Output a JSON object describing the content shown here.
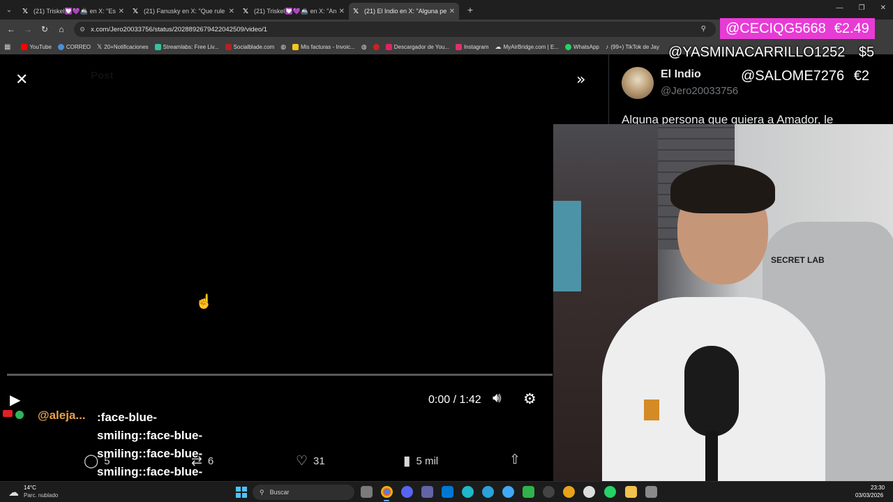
{
  "browser": {
    "tabs": [
      {
        "title": "(21) Triskel💟💜🚢 en X: \"Es o",
        "active": false
      },
      {
        "title": "(21) Fanusky en X: \"Que rule es",
        "active": false
      },
      {
        "title": "(21) Triskel💟💜🚢 en X: \"Ant",
        "active": false
      },
      {
        "title": "(21) El Indio en X: \"Alguna pers",
        "active": true
      }
    ],
    "url": "x.com/Jero20033756/status/2028892679422042509/video/1",
    "bookmarks": [
      {
        "label": "YouTube",
        "color": "#ff0000"
      },
      {
        "label": "CORREO",
        "color": "#4a90d9"
      },
      {
        "label": "20+Notificaciones",
        "color": "#ffffff"
      },
      {
        "label": "Streamlabs: Free Liv...",
        "color": "#31c3a2"
      },
      {
        "label": "Socialblade.com",
        "color": "#b22222"
      },
      {
        "label": "",
        "color": "#888888"
      },
      {
        "label": "Mis facturas - Invoic...",
        "color": "#f5c518"
      },
      {
        "label": "",
        "color": "#888888"
      },
      {
        "label": "",
        "color": "#cc2222"
      },
      {
        "label": "Descargador de You...",
        "color": "#e0245e"
      },
      {
        "label": "Instagram",
        "color": "#e1306c"
      },
      {
        "label": "MyAirBridge.com | E...",
        "color": "#777777"
      },
      {
        "label": "WhatsApp",
        "color": "#25d366"
      },
      {
        "label": "(99+) TikTok de Jay",
        "color": "#000000"
      }
    ],
    "bookmarks_folder": "Todos los marcadores"
  },
  "video": {
    "time_display": "0:00 / 1:42",
    "progress": 0.0,
    "ghost_header": "Post"
  },
  "tweet": {
    "author_name": "El Indio",
    "author_handle": "@Jero20033756",
    "text": "Alguna persona que quiera a Amador, le",
    "replies": "5",
    "reposts": "6",
    "likes": "31",
    "views": "5 mil"
  },
  "chat": {
    "username": "@aleja...",
    "message": ":face-blue-smiling::face-blue-smiling::face-blue-smiling::face-blue-smiling:"
  },
  "donations": [
    {
      "user": "@CECIQG5668",
      "amount": "€2.49"
    },
    {
      "user": "@YASMINACARRILLO1252",
      "amount": "$5"
    },
    {
      "user": "@SALOME7276",
      "amount": "€2"
    }
  ],
  "webcam": {
    "chair_brand": "SECRET LAB"
  },
  "taskbar": {
    "weather_temp": "14°C",
    "weather_desc": "Parc. nublado",
    "search_placeholder": "Buscar",
    "time": "23:30",
    "date": "03/03/2026"
  }
}
